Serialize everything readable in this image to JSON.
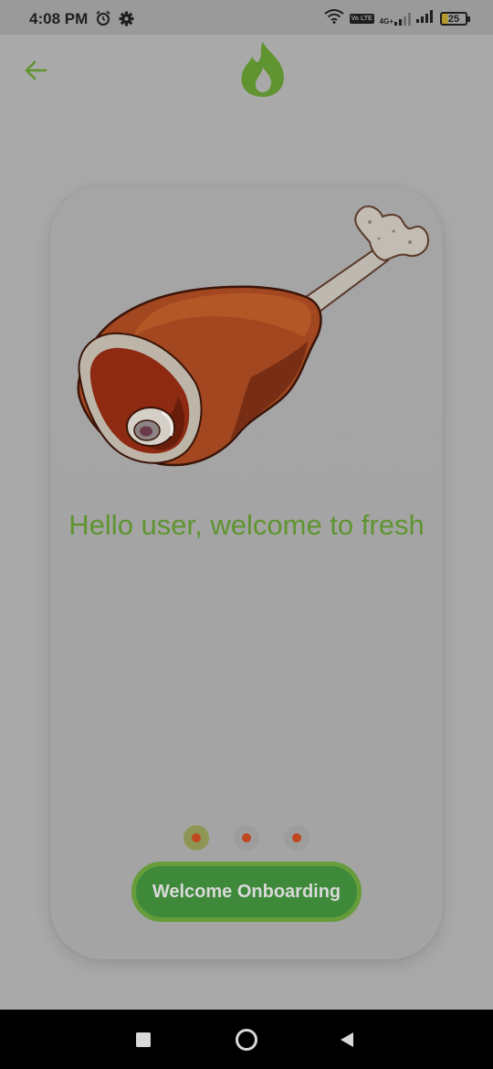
{
  "status_bar": {
    "time": "4:08 PM",
    "left_icons": [
      "alarm-icon",
      "gear-icon"
    ],
    "right_icons": [
      "wifi-icon",
      "volte-icon",
      "signal-4g-icon",
      "signal-icon",
      "battery-icon"
    ],
    "volte_label": "Vo LTE",
    "network_label": "4G+",
    "battery_level": "25"
  },
  "header": {
    "back_icon": "arrow-left-icon",
    "logo_icon": "flame-logo-icon"
  },
  "onboarding": {
    "illustration": "chicken-leg-illustration",
    "message": "Hello user, welcome to fresh",
    "pages_total": 3,
    "current_page": 1,
    "button_label": "Welcome Onboarding"
  },
  "nav_bar": {
    "buttons": [
      "recents-square-icon",
      "home-circle-icon",
      "back-triangle-icon"
    ]
  },
  "colors": {
    "accent_green": "#5f9430",
    "button_green": "#3e8a3a",
    "dot_orange": "#c0481f"
  }
}
